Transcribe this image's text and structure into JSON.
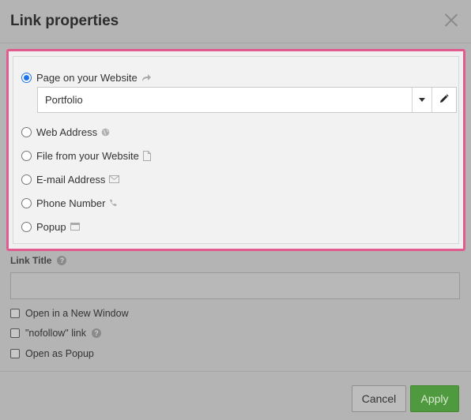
{
  "dialog": {
    "title": "Link properties"
  },
  "link_type": {
    "selected": "page",
    "options": [
      {
        "label": "Page on your Website",
        "icon": "share-arrow-icon",
        "checked": true
      },
      {
        "label": "Web Address",
        "icon": "globe-icon",
        "checked": false
      },
      {
        "label": "File from your Website",
        "icon": "file-icon",
        "checked": false
      },
      {
        "label": "E-mail Address",
        "icon": "envelope-icon",
        "checked": false
      },
      {
        "label": "Phone Number",
        "icon": "phone-icon",
        "checked": false
      },
      {
        "label": "Popup",
        "icon": "window-icon",
        "checked": false
      }
    ],
    "page_select": {
      "value": "Portfolio"
    }
  },
  "link_title": {
    "label": "Link Title",
    "value": "",
    "placeholder": ""
  },
  "checkboxes": [
    {
      "label": "Open in a New Window",
      "checked": false
    },
    {
      "label": "\"nofollow\" link",
      "checked": false,
      "help": true
    },
    {
      "label": "Open as Popup",
      "checked": false
    }
  ],
  "footer": {
    "cancel_label": "Cancel",
    "apply_label": "Apply"
  },
  "colors": {
    "highlight_border": "#e05c8e",
    "radio_selected": "#1a73e8",
    "apply_button": "#4f9a3e"
  }
}
